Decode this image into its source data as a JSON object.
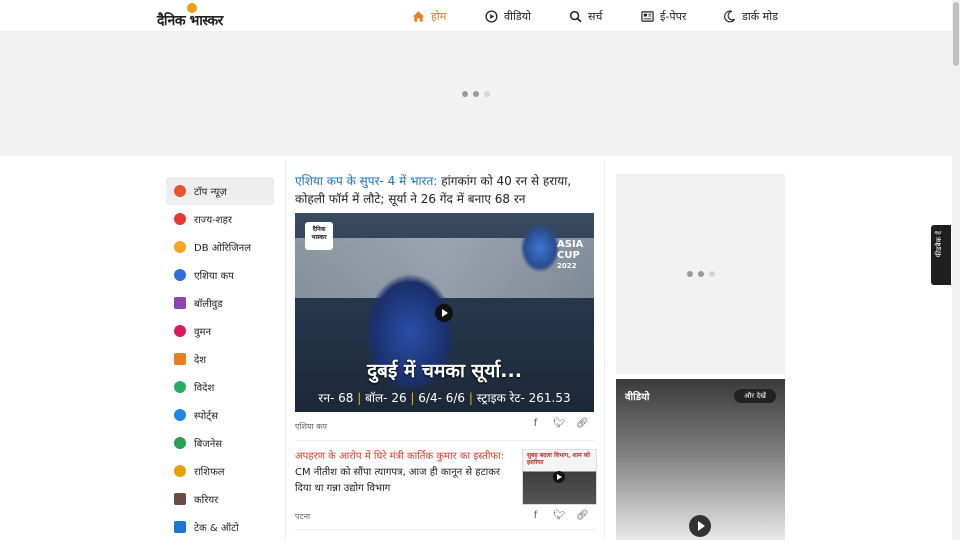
{
  "header": {
    "logo_text": "दैनिक भास्कर",
    "nav": [
      {
        "label": "होम",
        "icon": "home-icon",
        "active": true
      },
      {
        "label": "वीडियो",
        "icon": "play-circle-icon"
      },
      {
        "label": "सर्च",
        "icon": "search-icon"
      },
      {
        "label": "ई-पेपर",
        "icon": "newspaper-icon"
      },
      {
        "label": "डार्क मोड",
        "icon": "moon-icon"
      }
    ]
  },
  "colors": {
    "accent": "#e67e22",
    "kicker_blue": "#1a73c8",
    "kicker_red": "#e0402f"
  },
  "sidebar": {
    "items": [
      {
        "label": "टॉप न्यूज़",
        "icon": "flame-icon",
        "color": "#e8542f"
      },
      {
        "label": "राज्य-शहर",
        "icon": "location-pin-icon",
        "color": "#e53935"
      },
      {
        "label": "DB ओरिजिनल",
        "icon": "db-original-icon",
        "color": "#f5a623"
      },
      {
        "label": "एशिया कप",
        "icon": "cricket-icon",
        "color": "#2f6fd6"
      },
      {
        "label": "बॉलीवुड",
        "icon": "clapperboard-icon",
        "color": "#8e44ad"
      },
      {
        "label": "वुमन",
        "icon": "woman-icon",
        "color": "#d81b60"
      },
      {
        "label": "देश",
        "icon": "india-gate-icon",
        "color": "#e67e22"
      },
      {
        "label": "विदेश",
        "icon": "globe-icon",
        "color": "#27ae60"
      },
      {
        "label": "स्पोर्ट्स",
        "icon": "runner-icon",
        "color": "#1e88e5"
      },
      {
        "label": "बिजनेस",
        "icon": "rupee-icon",
        "color": "#2e9e4f"
      },
      {
        "label": "राशिफल",
        "icon": "zodiac-icon",
        "color": "#e6a100"
      },
      {
        "label": "करियर",
        "icon": "graduation-cap-icon",
        "color": "#6d4c41"
      },
      {
        "label": "टेक & ऑटो",
        "icon": "car-icon",
        "color": "#1976d2"
      }
    ]
  },
  "main": {
    "story1": {
      "kicker": "एशिया कप के सुपर- 4 में भारत:",
      "headline": " हांगकांग को 40 रन से हराया, कोहली फॉर्म में लौटे; सूर्या ने 26 गेंद में बनाए 68 रन",
      "image_logo": "दैनिक भास्कर",
      "image_badge_line1": "ASIA",
      "image_badge_line2": "CUP",
      "image_badge_line3": "2022",
      "image_caption": "दुबई में चमका सूर्या...",
      "stats": [
        "रन- 68",
        "बॉल- 26",
        "6/4- 6/6",
        "स्ट्राइक रेट- 261.53"
      ],
      "category": "एशिया कप"
    },
    "story2": {
      "kicker": "अपहरण के आरोप में घिरे मंत्री कार्तिक कुमार का इस्तीफा:",
      "headline": " CM नीतीश को सौंपा त्यागपत्र, आज ही कानून से हटाकर दिया था गन्ना उद्योग विभाग",
      "thumb_text": "सुबह बदला विभाग, शाम को इस्तीफा",
      "category": "पटना"
    }
  },
  "right": {
    "video_title": "वीडियो",
    "more_label": "और देखें"
  },
  "feedback": {
    "label": "फीडबैक दें"
  }
}
